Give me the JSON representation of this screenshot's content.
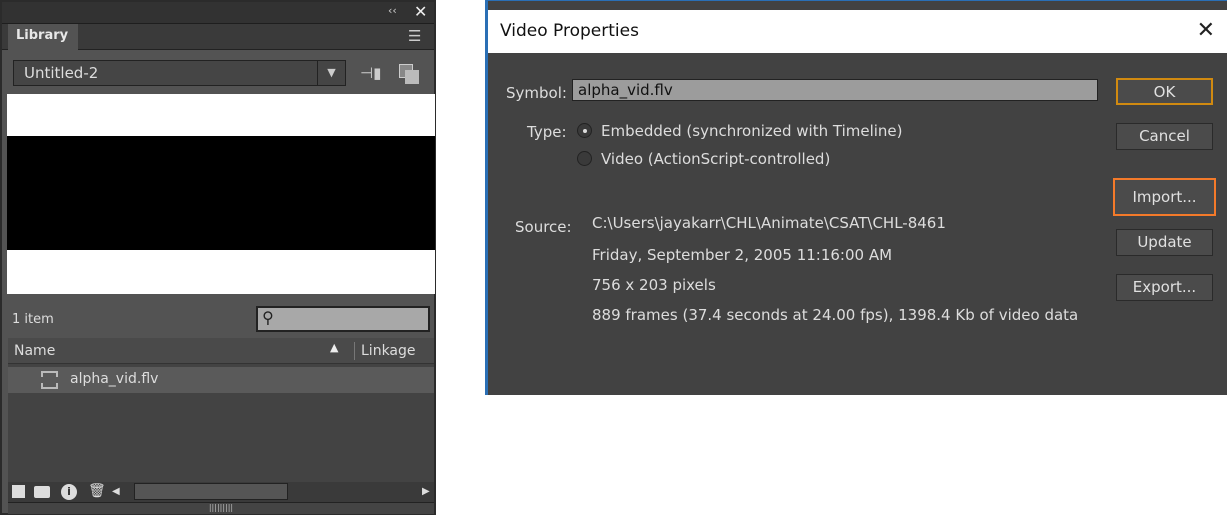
{
  "library": {
    "title": "Library",
    "document": "Untitled-2",
    "item_count": "1 item",
    "columns": {
      "name": "Name",
      "linkage": "Linkage"
    },
    "items": [
      {
        "name": "alpha_vid.flv",
        "type": "video"
      }
    ]
  },
  "dialog": {
    "title": "Video Properties",
    "symbol_label": "Symbol:",
    "symbol_value": "alpha_vid.flv",
    "type_label": "Type:",
    "type_options": [
      "Embedded (synchronized with Timeline)",
      "Video (ActionScript-controlled)"
    ],
    "source_label": "Source:",
    "source_path": "C:\\Users\\jayakarr\\CHL\\Animate\\CSAT\\CHL-8461",
    "source_date": "Friday, September 2, 2005  11:16:00 AM",
    "source_dimensions": "756 x 203 pixels",
    "source_info": "889 frames (37.4 seconds at 24.00 fps), 1398.4 Kb of video data",
    "buttons": {
      "ok": "OK",
      "cancel": "Cancel",
      "import": "Import...",
      "update": "Update",
      "export": "Export..."
    },
    "highlight_color": "#f47a2a",
    "focus_color": "#d18a10"
  }
}
